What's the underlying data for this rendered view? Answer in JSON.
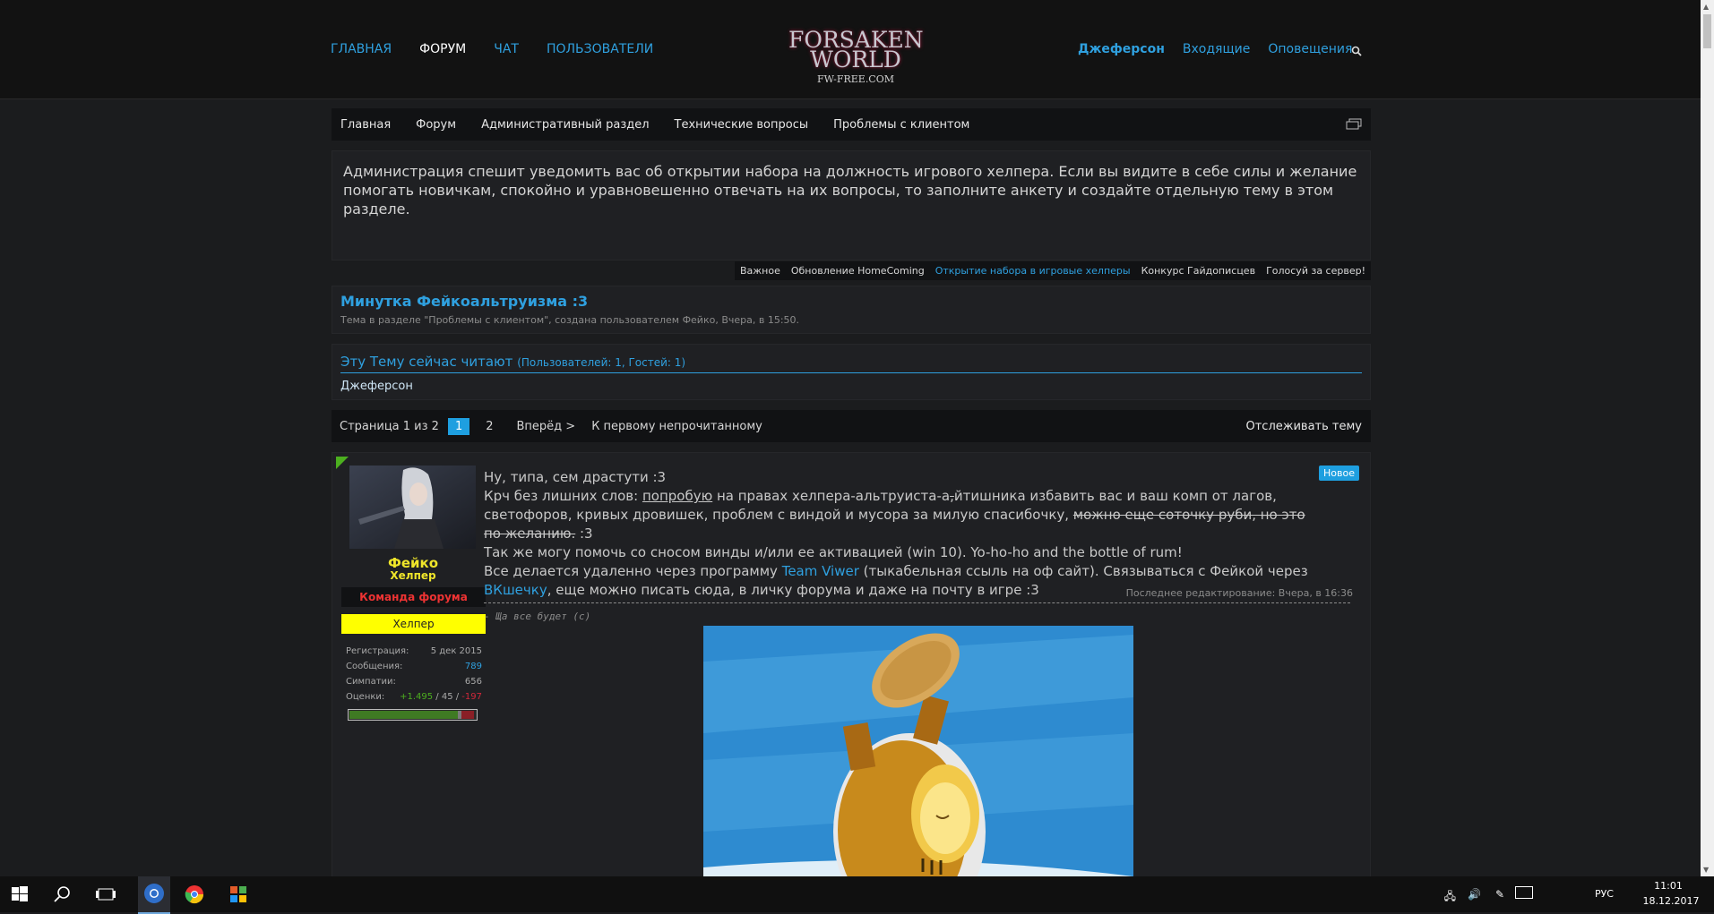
{
  "header": {
    "nav_left": [
      "ГЛАВНАЯ",
      "ФОРУМ",
      "ЧАТ",
      "ПОЛЬЗОВАТЕЛИ"
    ],
    "logo_line1": "FORSAKEN",
    "logo_line2": "WORLD",
    "logo_line3": "FW-FREE.COM",
    "nav_right": [
      "Джеферсон",
      "Входящие",
      "Оповещения"
    ],
    "search_icon": "search-icon"
  },
  "breadcrumb": [
    "Главная",
    "Форум",
    "Административный раздел",
    "Технические вопросы",
    "Проблемы с клиентом"
  ],
  "notice": {
    "text": "Администрация спешит уведомить вас об открытии набора на должность игрового хелпера. Если вы видите в себе силы и желание помогать новичкам, спокойно и уравновешенно отвечать на их вопросы, то заполните анкету и создайте отдельную тему в этом разделе.",
    "tabs": [
      "Важное",
      "Обновление HomeComing",
      "Открытие набора в игровые хелперы",
      "Конкурс Гайдописцев",
      "Голосуй за сервер!"
    ]
  },
  "thread": {
    "title": "Минутка Фейкоальтруизма :3",
    "desc": "Тема в разделе \"Проблемы с клиентом\", создана пользователем Фейко, Вчера, в 15:50."
  },
  "viewers": {
    "title": "Эту Тему сейчас читают",
    "counts": "(Пользователей: 1, Гостей: 1)",
    "users": "Джеферсон"
  },
  "pagenav": {
    "label": "Страница 1 из 2",
    "pages": [
      "1",
      "2"
    ],
    "next": "Вперёд >",
    "first_unread": "К первому непрочитанному",
    "watch": "Отслеживать тему"
  },
  "post": {
    "new_badge": "Новое",
    "author": "Фейко",
    "author_title": "Хелпер",
    "team_badge": "Команда форума",
    "helper_badge": "Хелпер",
    "stats": {
      "reg_label": "Регистрация:",
      "reg_value": "5 дек 2015",
      "msgs_label": "Сообщения:",
      "msgs_value": "789",
      "likes_label": "Симпатии:",
      "likes_value": "656",
      "ratings_label": "Оценки:",
      "rating_pos": "+1.495",
      "rating_neu": "45",
      "rating_neg": "-197",
      "rating_sep": " / "
    },
    "lines": {
      "l1": "Ну, типа, сем драстути :3",
      "l2a": "Крч без лишних слов: ",
      "l2b": "попробую",
      "l2c": " на правах хелпера-альтруиста-а",
      "l2d": ",",
      "l2e": "йтишника избавить вас и ваш комп от лагов, светофоров, кривых дровишек, проблем с виндой и мусора за милую спасибочку, ",
      "l2f": "можно еще соточку руби, но это по желанию.",
      "l2g": " :3",
      "l3": "Так же могу помочь со сносом винды и/или ее активацией (win 10). Yo-ho-ho and the bottle of rum!",
      "l4a": "Все делается удаленно через программу ",
      "l4b": "Team Viwer",
      "l4c": " (тыкабельная ссыль на оф сайт). Связываться с Фейкой через ",
      "l4d": "ВКшечку",
      "l4e": ", еще можно писать сюда, в личку форума и даже на почту в игре :3"
    },
    "edited": "Последнее редактирование: Вчера, в 16:36",
    "signature": "- Ща все будет (с)"
  },
  "taskbar": {
    "lang": "РУС",
    "time": "11:01",
    "date": "18.12.2017"
  }
}
